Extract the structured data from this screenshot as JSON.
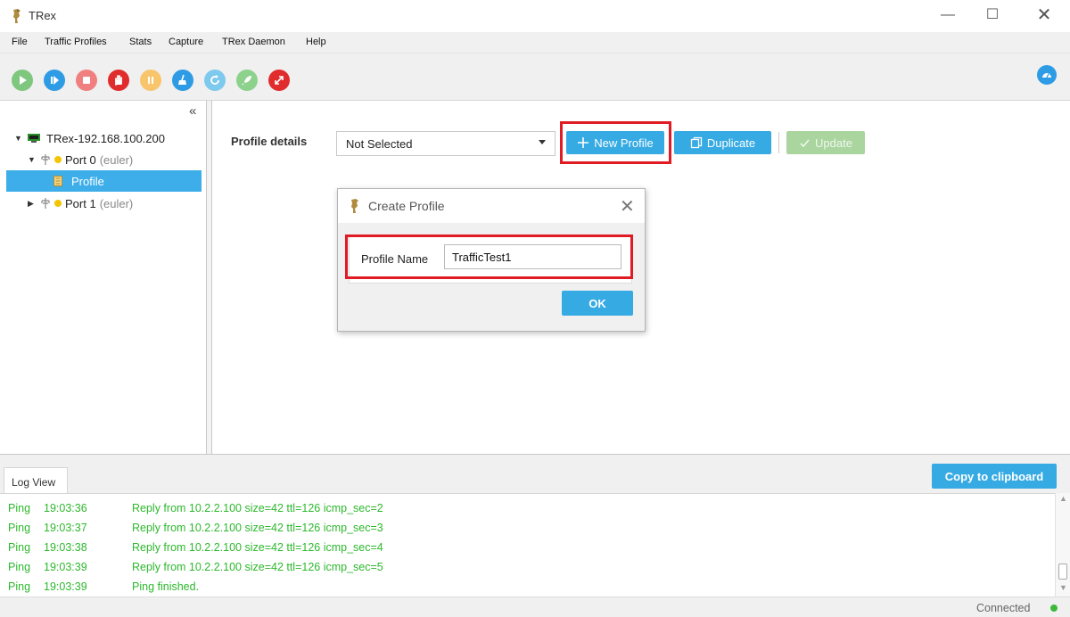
{
  "window": {
    "title": "TRex",
    "controls": {
      "minimize": "—",
      "maximize": "☐",
      "close": "✕"
    }
  },
  "menu": [
    "File",
    "Traffic Profiles",
    "Stats",
    "Capture",
    "TRex Daemon",
    "Help"
  ],
  "toolbar": {
    "buttons": [
      {
        "name": "start",
        "icon": "play-icon",
        "color": "#7fc77f"
      },
      {
        "name": "start-resume",
        "icon": "play-next-icon",
        "color": "#2e9be5"
      },
      {
        "name": "stop",
        "icon": "stop-icon",
        "color": "#f08080"
      },
      {
        "name": "stop-all",
        "icon": "hand-icon",
        "color": "#e02c2c"
      },
      {
        "name": "pause",
        "icon": "pause-icon",
        "color": "#f8c56c"
      },
      {
        "name": "clear",
        "icon": "broom-icon",
        "color": "#2e9be5"
      },
      {
        "name": "refresh",
        "icon": "refresh-icon",
        "color": "#7ec9ee"
      },
      {
        "name": "launch",
        "icon": "rocket-icon",
        "color": "#8cd18c"
      },
      {
        "name": "disconnect",
        "icon": "disconnect-icon",
        "color": "#e02c2c"
      }
    ],
    "dashboard_icon": "dashboard-icon"
  },
  "tree": {
    "collapse_glyph": "«",
    "server": {
      "label": "TRex-192.168.100.200"
    },
    "port0": {
      "label": "Port 0",
      "sub": "(euler)"
    },
    "profile": {
      "label": "Profile"
    },
    "port1": {
      "label": "Port 1",
      "sub": "(euler)"
    }
  },
  "main": {
    "profile_details_label": "Profile details",
    "profile_select_value": "Not Selected",
    "new_profile_label": "New Profile",
    "duplicate_label": "Duplicate",
    "update_label": "Update"
  },
  "dialog": {
    "title": "Create Profile",
    "close_glyph": "✕",
    "field_label": "Profile Name",
    "field_value": "TrafficTest1",
    "ok_label": "OK"
  },
  "log": {
    "tab_label": "Log View",
    "copy_label": "Copy to clipboard",
    "lines": [
      {
        "source": "Ping",
        "time": "19:03:36",
        "message": "Reply from 10.2.2.100 size=42 ttl=126 icmp_sec=2"
      },
      {
        "source": "Ping",
        "time": "19:03:37",
        "message": "Reply from 10.2.2.100 size=42 ttl=126 icmp_sec=3"
      },
      {
        "source": "Ping",
        "time": "19:03:38",
        "message": "Reply from 10.2.2.100 size=42 ttl=126 icmp_sec=4"
      },
      {
        "source": "Ping",
        "time": "19:03:39",
        "message": "Reply from 10.2.2.100 size=42 ttl=126 icmp_sec=5"
      },
      {
        "source": "Ping",
        "time": "19:03:39",
        "message": "Ping finished."
      }
    ]
  },
  "status": {
    "text": "Connected",
    "color": "#3cb93c"
  },
  "colors": {
    "accent": "#36aae3",
    "highlight": "#e01b24",
    "log_text": "#2db82d",
    "selection": "#3daee9"
  }
}
